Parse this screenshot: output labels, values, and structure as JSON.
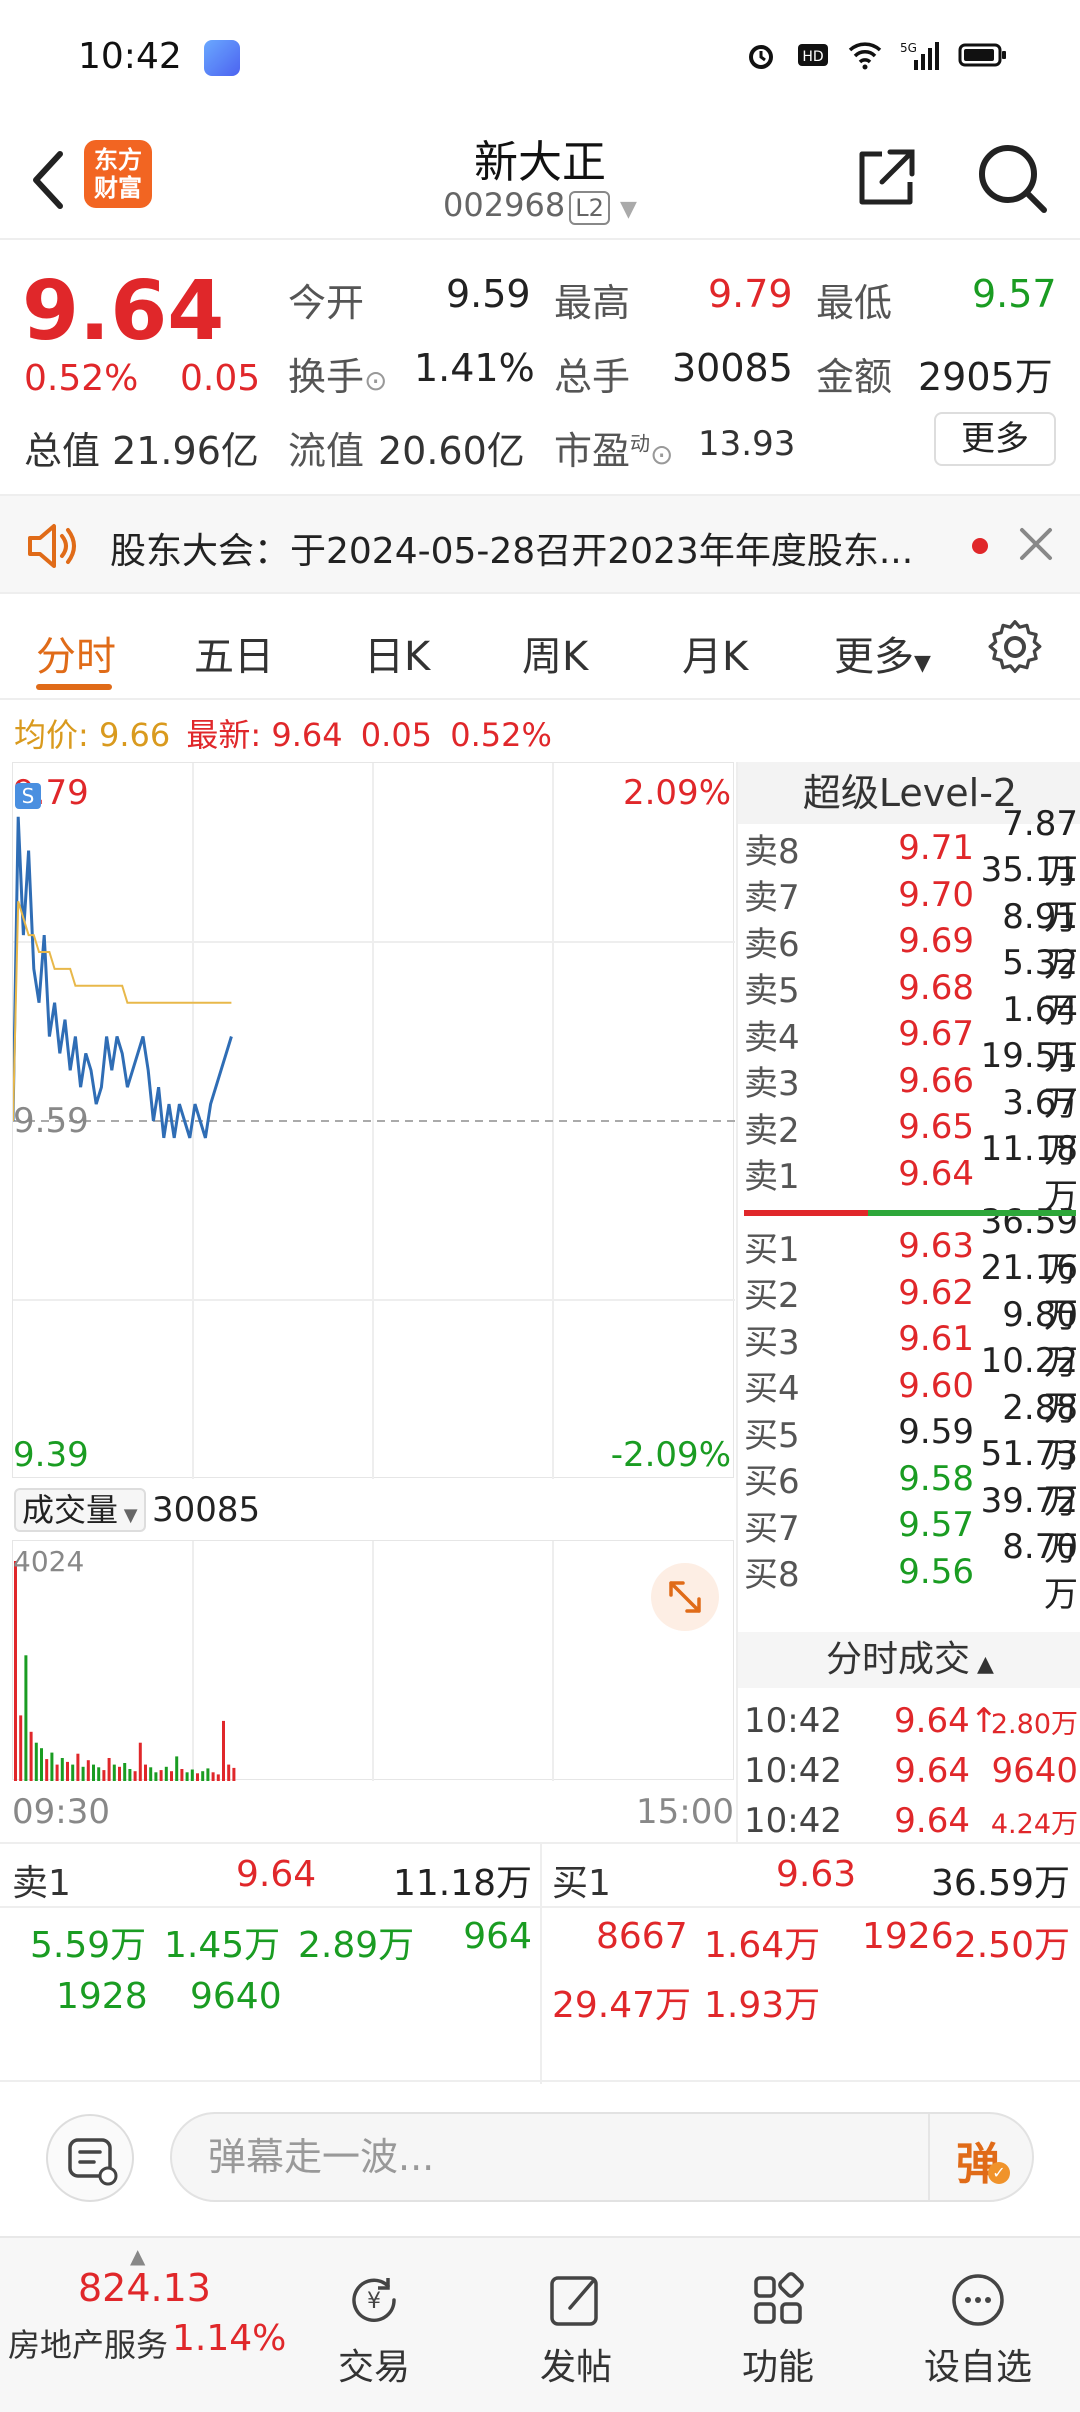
{
  "status_bar": {
    "time": "10:42"
  },
  "header": {
    "logo_text_line1": "东方",
    "logo_text_line2": "财富",
    "stock_name": "新大正",
    "stock_code": "002968",
    "level_badge": "L2"
  },
  "quote": {
    "price": "9.64",
    "change_pct": "0.52%",
    "change": "0.05",
    "open_label": "今开",
    "open": "9.59",
    "high_label": "最高",
    "high": "9.79",
    "low_label": "最低",
    "low": "9.57",
    "turnover_label": "换手",
    "turnover": "1.41%",
    "volume_label": "总手",
    "volume": "30085",
    "amount_label": "金额",
    "amount": "2905万",
    "mktcap": "总值 21.96亿",
    "float_label": "流值",
    "float_cap": "20.60亿",
    "pe_label": "市盈",
    "pe_sup": "动",
    "pe": "13.93",
    "more_label": "更多"
  },
  "notice": {
    "text": "股东大会：于2024-05-28召开2023年年度股东..."
  },
  "tabs": [
    "分时",
    "五日",
    "日K",
    "周K",
    "月K",
    "更多"
  ],
  "chart": {
    "avg_label": "均价:",
    "avg_value": "9.66",
    "latest_label": "最新:",
    "latest_value": "9.64",
    "latest_chg": "0.05",
    "latest_pct": "0.52%",
    "y_max": "9.79",
    "y_ref": "9.59",
    "y_min": "9.39",
    "pct_max": "2.09%",
    "pct_min": "-2.09%",
    "marker": "S",
    "vol_label": "成交量",
    "vol_value": "30085",
    "vol_max": "4024",
    "time_start": "09:30",
    "time_end": "15:00"
  },
  "chart_data": {
    "type": "line",
    "series": [
      {
        "values": [
          9.59,
          9.77,
          9.7,
          9.75,
          9.68,
          9.66,
          9.7,
          9.64,
          9.66,
          9.63,
          9.65,
          9.62,
          9.64,
          9.61,
          9.63,
          9.62,
          9.6,
          9.61,
          9.64,
          9.62,
          9.64,
          9.63,
          9.61,
          9.62,
          9.63,
          9.64,
          9.62,
          9.59,
          9.61,
          9.58,
          9.6,
          9.58,
          9.6,
          9.59,
          9.58,
          9.6,
          9.59,
          9.58,
          9.6,
          9.61,
          9.62,
          9.63,
          9.64
        ]
      },
      {
        "values": [
          9.59,
          9.72,
          9.71,
          9.7,
          9.7,
          9.69,
          9.69,
          9.69,
          9.68,
          9.68,
          9.68,
          9.68,
          9.67,
          9.67,
          9.67,
          9.67,
          9.67,
          9.67,
          9.67,
          9.67,
          9.67,
          9.67,
          9.66,
          9.66,
          9.66,
          9.66,
          9.66,
          9.66,
          9.66,
          9.66,
          9.66,
          9.66,
          9.66,
          9.66,
          9.66,
          9.66,
          9.66,
          9.66,
          9.66,
          9.66,
          9.66,
          9.66,
          9.66
        ]
      }
    ],
    "ylim": [
      9.39,
      9.79
    ],
    "volume": [
      4024,
      1200,
      2300,
      900,
      700,
      600,
      400,
      520,
      300,
      420,
      350,
      300,
      500,
      260,
      380,
      300,
      250,
      200,
      420,
      300,
      260,
      330,
      220,
      180,
      700,
      300,
      250,
      160,
      200,
      260,
      180,
      450,
      220,
      160,
      210,
      140,
      180,
      230,
      160,
      120,
      1100,
      300,
      240
    ]
  },
  "orderbook": {
    "title": "超级Level-2",
    "asks": [
      {
        "label": "卖8",
        "price": "9.71",
        "qty": "7.87万"
      },
      {
        "label": "卖7",
        "price": "9.70",
        "qty": "35.11万"
      },
      {
        "label": "卖6",
        "price": "9.69",
        "qty": "8.91万"
      },
      {
        "label": "卖5",
        "price": "9.68",
        "qty": "5.32万"
      },
      {
        "label": "卖4",
        "price": "9.67",
        "qty": "1.64万"
      },
      {
        "label": "卖3",
        "price": "9.66",
        "qty": "19.51万"
      },
      {
        "label": "卖2",
        "price": "9.65",
        "qty": "3.67万"
      },
      {
        "label": "卖1",
        "price": "9.64",
        "qty": "11.18万"
      }
    ],
    "bids": [
      {
        "label": "买1",
        "price": "9.63",
        "qty": "36.59万"
      },
      {
        "label": "买2",
        "price": "9.62",
        "qty": "21.16万"
      },
      {
        "label": "买3",
        "price": "9.61",
        "qty": "9.80万"
      },
      {
        "label": "买4",
        "price": "9.60",
        "qty": "10.22万"
      },
      {
        "label": "买5",
        "price": "9.59",
        "qty": "2.88万"
      },
      {
        "label": "买6",
        "price": "9.58",
        "qty": "51.73万"
      },
      {
        "label": "买7",
        "price": "9.57",
        "qty": "39.72万"
      },
      {
        "label": "买8",
        "price": "9.56",
        "qty": "8.70万"
      }
    ],
    "trades_title": "分时成交",
    "trades": [
      {
        "time": "10:42",
        "price": "9.64↑",
        "vol": "2.80万"
      },
      {
        "time": "10:42",
        "price": "9.64",
        "vol": "9640"
      },
      {
        "time": "10:42",
        "price": "9.64",
        "vol": "4.24万"
      }
    ]
  },
  "queue": {
    "sell_label": "卖1",
    "sell_price": "9.64",
    "sell_qty": "11.18万",
    "buy_label": "买1",
    "buy_price": "9.63",
    "buy_qty": "36.59万",
    "sell_orders": [
      "5.59万",
      "1.45万",
      "2.89万",
      "964",
      "1928",
      "9640"
    ],
    "buy_orders": [
      "8667",
      "1.64万",
      "1926",
      "2.50万",
      "29.47万",
      "1.93万"
    ]
  },
  "comment": {
    "placeholder": "弹幕走一波...",
    "danmu": "弹"
  },
  "bottom_nav": {
    "index_value": "824.13",
    "index_name": "房地产服务",
    "index_pct": "1.14%",
    "items": [
      "交易",
      "发帖",
      "功能",
      "设自选"
    ]
  }
}
